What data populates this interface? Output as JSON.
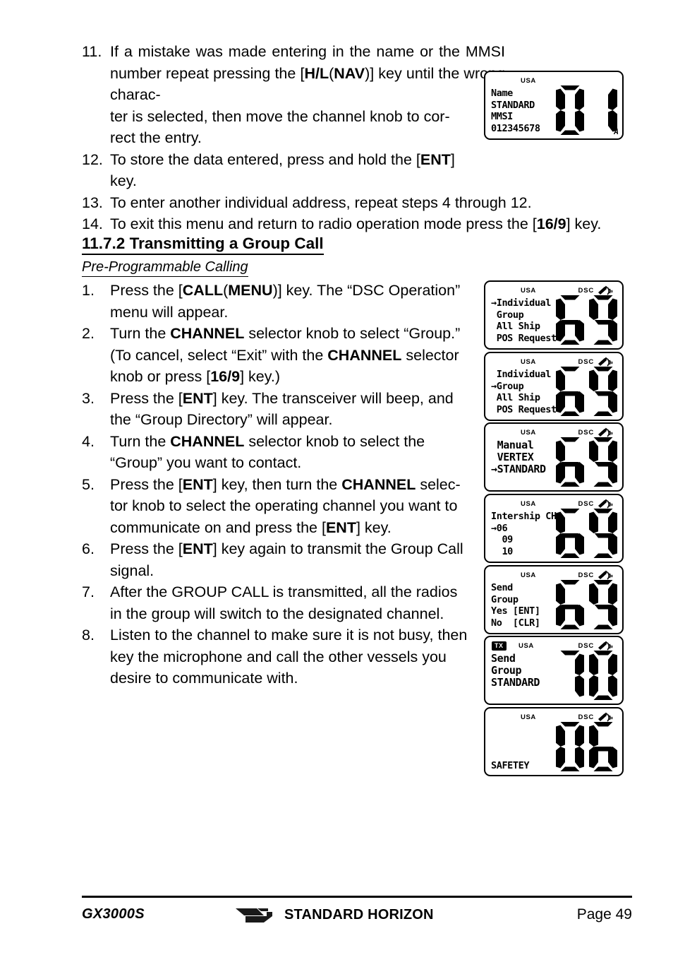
{
  "page": {
    "number_label": "Page 49",
    "model": "GX3000S",
    "brand": "STANDARD HORIZON"
  },
  "top_list": [
    {
      "num": "11.",
      "html": "If a mistake was made entering in the name or the MMSI number repeat pressing the [<b>H/L</b>(<b>NAV</b>)] key until the wrong charac-ter is selected, then move the channel knob to cor-rect the entry.",
      "text": "If a mistake was made entering in the name or the MMSI number repeat pressing the [H/L(NAV)] key until the wrong character is selected, then move the channel knob to correct the entry."
    },
    {
      "num": "12.",
      "text": "To store the data entered, press and hold the [ENT] key."
    },
    {
      "num": "13.",
      "text": "To enter another individual address, repeat steps 4 through 12."
    },
    {
      "num": "14.",
      "text": "To exit this menu and return to radio operation mode press the [16/9] key."
    }
  ],
  "section": {
    "heading": "11.7.2 Transmitting a Group Call",
    "subheading": "Pre-Programmable Calling"
  },
  "steps": [
    {
      "num": "1.",
      "text": "Press the [CALL(MENU)] key. The “DSC Operation” menu will appear."
    },
    {
      "num": "2.",
      "text": "Turn the CHANNEL selector knob to select “Group.” (To cancel, select “Exit” with the CHANNEL selector knob or press [16/9] key.)"
    },
    {
      "num": "3.",
      "text": "Press the [ENT] key. The transceiver will beep, and the “Group Directory” will appear."
    },
    {
      "num": "4.",
      "text": "Turn the CHANNEL selector knob to select the “Group” you want to contact."
    },
    {
      "num": "5.",
      "text": "Press the [ENT] key, then turn the CHANNEL selector knob to select the operating channel you want to communicate on and press the [ENT] key."
    },
    {
      "num": "6.",
      "text": "Press the [ENT] key again to transmit the Group Call signal."
    },
    {
      "num": "7.",
      "text": "After the GROUP CALL is transmitted, all the radios in the group will switch to the designated channel."
    },
    {
      "num": "8.",
      "text": "Listen to the channel to make sure it is not busy, then key the microphone and call the other vessels you desire to communicate with."
    }
  ],
  "lcds": [
    {
      "id": "lcd-name-mmsi",
      "usa": "USA",
      "tx": null,
      "dsc": null,
      "lines": [
        "Name",
        "STANDARD",
        "MMSI",
        "012345678"
      ],
      "digits": "01",
      "sub": "A"
    },
    {
      "id": "lcd-dsc-operation-individual",
      "usa": "USA",
      "tx": null,
      "dsc": "DSC",
      "lines": [
        "→Individual",
        " Group",
        " All Ship",
        " POS Request"
      ],
      "digits": "69",
      "sub": null
    },
    {
      "id": "lcd-dsc-operation-group",
      "usa": "USA",
      "tx": null,
      "dsc": "DSC",
      "lines": [
        " Individual",
        "→Group",
        " All Ship",
        " POS Request"
      ],
      "digits": "69",
      "sub": null
    },
    {
      "id": "lcd-group-directory",
      "usa": "USA",
      "tx": null,
      "dsc": "DSC",
      "lines": [
        " Manual",
        " VERTEX",
        "→STANDARD"
      ],
      "digits": "69",
      "sub": null
    },
    {
      "id": "lcd-intership-channel",
      "usa": "USA",
      "tx": null,
      "dsc": "DSC",
      "lines": [
        "Intership CH",
        "→06",
        "  09",
        "  10"
      ],
      "digits": "69",
      "sub": null
    },
    {
      "id": "lcd-send-group-confirm",
      "usa": "USA",
      "tx": null,
      "dsc": "DSC",
      "lines": [
        "Send",
        "Group",
        "Yes [ENT]",
        "No  [CLR]"
      ],
      "digits": "69",
      "sub": null
    },
    {
      "id": "lcd-send-group-transmitting",
      "usa": "USA",
      "tx": "TX",
      "dsc": "DSC",
      "lines": [
        "Send",
        "Group",
        "STANDARD"
      ],
      "digits": "70",
      "sub": null
    },
    {
      "id": "lcd-safety-channel",
      "usa": "USA",
      "tx": null,
      "dsc": "DSC",
      "lines": [
        "SAFETEY"
      ],
      "digits": "06",
      "sub": null
    }
  ]
}
